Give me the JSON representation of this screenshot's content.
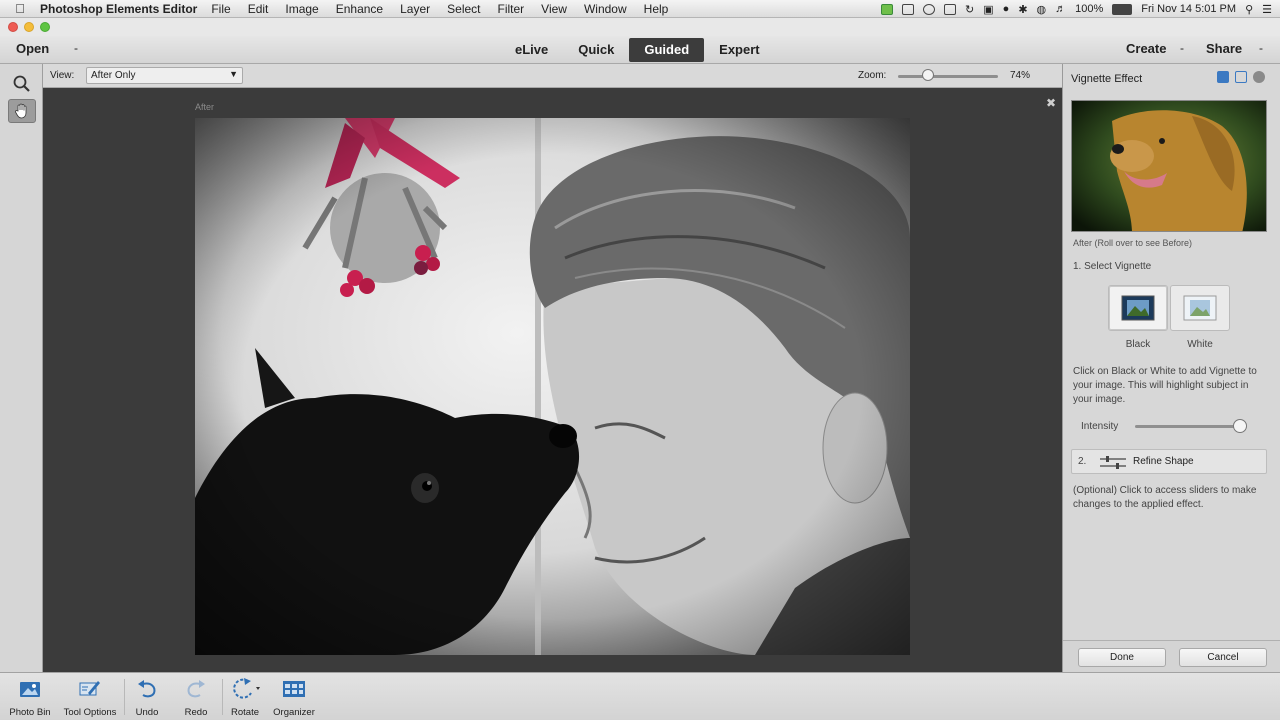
{
  "menubar": {
    "app_name": "Photoshop Elements Editor",
    "items": [
      "File",
      "Edit",
      "Image",
      "Enhance",
      "Layer",
      "Select",
      "Filter",
      "View",
      "Window",
      "Help"
    ],
    "battery": "100%",
    "clock": "Fri Nov 14  5:01 PM"
  },
  "modebar": {
    "open_label": "Open",
    "tabs": [
      "eLive",
      "Quick",
      "Guided",
      "Expert"
    ],
    "active_tab": "Guided",
    "create_label": "Create",
    "share_label": "Share"
  },
  "options": {
    "view_label": "View:",
    "view_value": "After Only",
    "zoom_label": "Zoom:",
    "zoom_value": "74%",
    "zoom_level": 0.3
  },
  "canvas": {
    "after_label": "After"
  },
  "panel": {
    "title": "Vignette Effect",
    "preview_caption": "After (Roll over to see Before)",
    "step1_label": "1. Select Vignette",
    "vignette_black": "Black",
    "vignette_white": "White",
    "step1_description": "Click on Black or White to add Vignette to your image. This will highlight subject in your image.",
    "intensity_label": "Intensity",
    "intensity_level": 0.95,
    "step2_number": "2.",
    "refine_label": "Refine Shape",
    "step2_description": "(Optional) Click to access sliders to make changes to the applied effect.",
    "done_label": "Done",
    "cancel_label": "Cancel"
  },
  "bottombar": {
    "photo_bin": "Photo Bin",
    "tool_options": "Tool Options",
    "undo": "Undo",
    "redo": "Redo",
    "rotate": "Rotate",
    "organizer": "Organizer"
  },
  "colors": {
    "accent_blue": "#2f6fb3",
    "active_tab_bg": "#3c3c3c",
    "canvas_bg": "#3b3b3b"
  }
}
